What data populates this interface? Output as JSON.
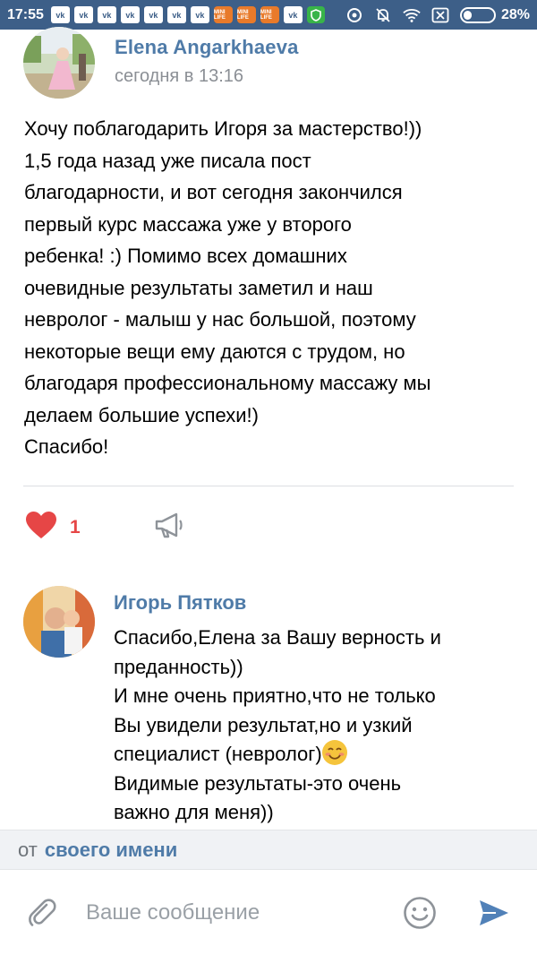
{
  "status_bar": {
    "time": "17:55",
    "notif_vk": "vk",
    "notif_mini": "MINI LIFE",
    "battery_pct": "28%",
    "battery_level": 0.28
  },
  "post": {
    "author": "Elena Angarkhaeva",
    "time": "сегодня в 13:16",
    "text": "Хочу поблагодарить Игоря за мастерство!))\n1,5 года назад уже писала пост\nблагодарности, и вот сегодня закончился\nпервый курс массажа уже у второго\nребенка! :) Помимо всех домашних\nочевидные результаты заметил и наш\nневролог - малыш у нас большой, поэтому\nнекоторые вещи ему даются с трудом, но\nблагодаря профессиональному массажу мы\nделаем большие успехи!)\nСпасибо!",
    "likes": "1",
    "icons": {
      "like": "heart-icon",
      "share": "megaphone-icon"
    }
  },
  "comment": {
    "author": "Игорь Пятков",
    "text_part1": "Спасибо,Елена за Вашу верность и\nпреданность))\nИ мне очень приятно,что не только\nВы увидели результат,но и узкий\nспециалист (невролог)",
    "text_part2": "\nВидимые результаты-это очень\nважно для меня))"
  },
  "compose": {
    "from_prefix": "от",
    "from_link": "своего имени",
    "placeholder": "Ваше сообщение",
    "icons": {
      "attach": "paperclip-icon",
      "emoji": "smiley-icon",
      "send": "send-icon"
    }
  },
  "colors": {
    "status_bar": "#3d5f88",
    "link": "#4f7ba8",
    "like": "#e64646",
    "send": "#5181b8"
  }
}
